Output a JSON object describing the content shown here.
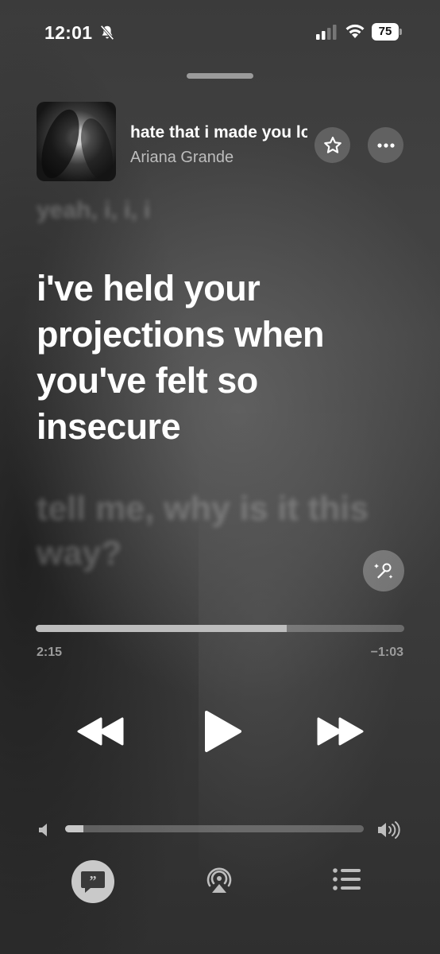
{
  "status_bar": {
    "time": "12:01",
    "battery_percent": "75",
    "icons": [
      "bell-slash-icon",
      "cellular-signal-icon",
      "wifi-icon",
      "battery-icon"
    ]
  },
  "now_playing": {
    "title": "hate that i made you love me",
    "artist": "Ariana Grande",
    "artwork_icon": "album-artwork"
  },
  "lyrics": {
    "previous": "yeah, i, i, i",
    "current": "i've held your projections when you've felt so insecure",
    "next": "tell me, why is it this way?"
  },
  "playback": {
    "elapsed": "2:15",
    "remaining": "−1:03",
    "progress_fraction": 0.68
  },
  "volume": {
    "level_fraction": 0.06
  },
  "colors": {
    "accent": "#ffffff",
    "secondary_text": "#bdbdbd",
    "background": "#3a3a3a"
  },
  "controls": [
    "star-icon",
    "more-icon",
    "sing-icon",
    "rewind-icon",
    "play-icon",
    "fast-forward-icon",
    "lyrics-icon",
    "airplay-icon",
    "queue-icon"
  ]
}
